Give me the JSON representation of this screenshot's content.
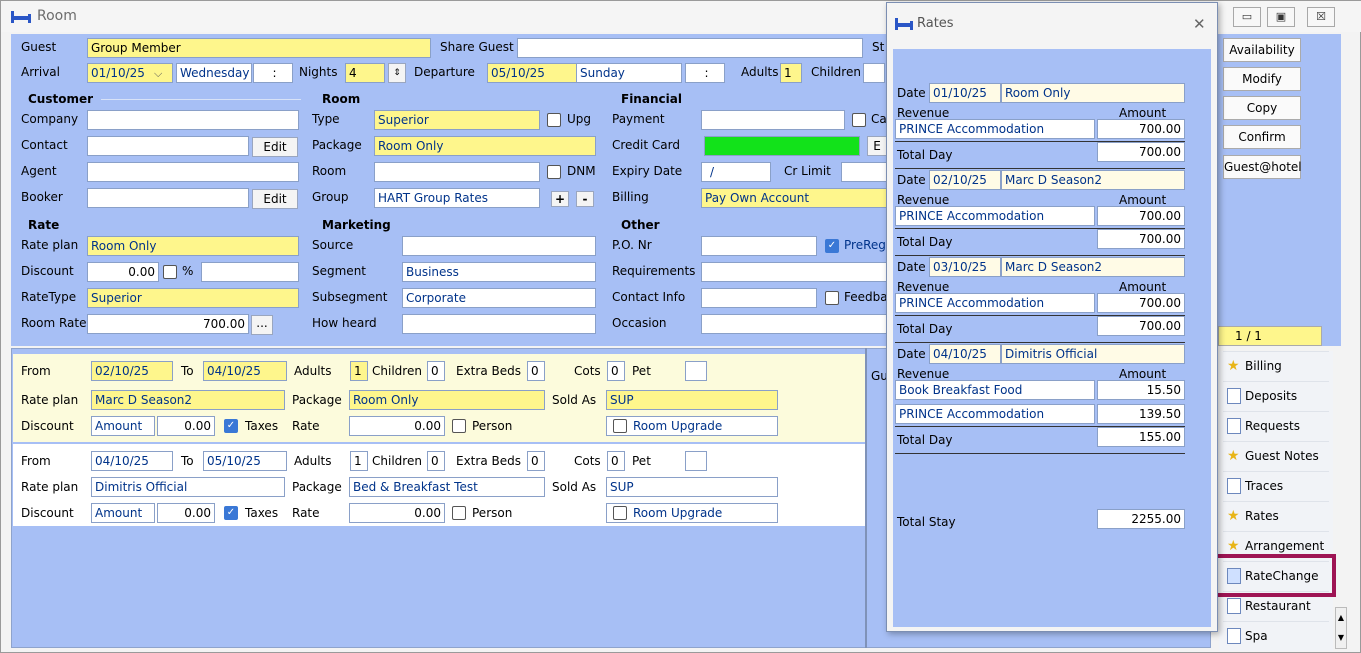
{
  "window": {
    "title": "Room",
    "min": "▭",
    "max": "▣",
    "close": "☒"
  },
  "guest": {
    "label": "Guest",
    "value": "Group Member",
    "share_label": "Share Guest",
    "share_value": "",
    "st_label": "St"
  },
  "arrival": {
    "label": "Arrival",
    "date": "01/10/25",
    "day": "Wednesday",
    "time": ":",
    "nights_label": "Nights",
    "nights": "4",
    "departure_label": "Departure",
    "dep_date": "05/10/25",
    "dep_day": "Sunday",
    "dep_time": ":",
    "adults_label": "Adults",
    "adults": "1",
    "children_label": "Children"
  },
  "customer": {
    "title": "Customer",
    "company": "Company",
    "contact": "Contact",
    "agent": "Agent",
    "booker": "Booker",
    "edit": "Edit"
  },
  "room": {
    "title": "Room",
    "type_label": "Type",
    "type": "Superior",
    "upg": "Upg",
    "package_label": "Package",
    "package": "Room Only",
    "room_label": "Room",
    "dnm": "DNM",
    "group_label": "Group",
    "group": "HART Group Rates",
    "plus": "+",
    "minus": "-"
  },
  "financial": {
    "title": "Financial",
    "payment": "Payment",
    "credit": "Credit Card",
    "expiry": "Expiry Date",
    "expiry_val": "/",
    "cr_limit": "Cr Limit",
    "billing": "Billing",
    "billing_val": "Pay Own Account",
    "ca": "Ca",
    "e": "E"
  },
  "rate": {
    "title": "Rate",
    "plan_label": "Rate plan",
    "plan": "Room Only",
    "discount_label": "Discount",
    "discount": "0.00",
    "pct": "%",
    "ratetype_label": "RateType",
    "ratetype": "Superior",
    "roomrate_label": "Room Rate",
    "roomrate": "700.00",
    "dots": "..."
  },
  "marketing": {
    "title": "Marketing",
    "source": "Source",
    "segment": "Segment",
    "segment_val": "Business",
    "subsegment": "Subsegment",
    "subsegment_val": "Corporate",
    "howheard": "How heard"
  },
  "other": {
    "title": "Other",
    "po": "P.O. Nr",
    "prereg": "PreReg",
    "requirements": "Requirements",
    "contact": "Contact Info",
    "feedback": "Feedba",
    "occasion": "Occasion"
  },
  "segments": [
    {
      "from_label": "From",
      "from": "02/10/25",
      "to_label": "To",
      "to": "04/10/25",
      "adults_label": "Adults",
      "adults": "1",
      "children_label": "Children",
      "children": "0",
      "extra_label": "Extra Beds",
      "extra": "0",
      "cots_label": "Cots",
      "cots": "0",
      "pet_label": "Pet",
      "plan_label": "Rate plan",
      "plan": "Marc D Season2",
      "package_label": "Package",
      "package": "Room Only",
      "sold_label": "Sold As",
      "sold": "SUP",
      "disc_label": "Discount",
      "disc_type": "Amount",
      "disc": "0.00",
      "taxes": "Taxes",
      "rate_label": "Rate",
      "rate": "0.00",
      "person": "Person",
      "upgrade": "Room Upgrade"
    },
    {
      "from_label": "From",
      "from": "04/10/25",
      "to_label": "To",
      "to": "05/10/25",
      "adults_label": "Adults",
      "adults": "1",
      "children_label": "Children",
      "children": "0",
      "extra_label": "Extra Beds",
      "extra": "0",
      "cots_label": "Cots",
      "cots": "0",
      "pet_label": "Pet",
      "plan_label": "Rate plan",
      "plan": "Dimitris Official",
      "package_label": "Package",
      "package": "Bed & Breakfast Test",
      "sold_label": "Sold As",
      "sold": "SUP",
      "disc_label": "Discount",
      "disc_type": "Amount",
      "disc": "0.00",
      "taxes": "Taxes",
      "rate_label": "Rate",
      "rate": "0.00",
      "person": "Person",
      "upgrade": "Room Upgrade"
    }
  ],
  "gu_label": "Gu",
  "side_buttons": [
    "Availability",
    "Modify",
    "Copy",
    "Confirm",
    "Guest@hotel"
  ],
  "page_counter": "1 / 1",
  "side_items": [
    "Billing",
    "Deposits",
    "Requests",
    "Guest Notes",
    "Traces",
    "Rates",
    "Arrangement",
    "RateChange",
    "Restaurant",
    "Spa"
  ],
  "rates_dialog": {
    "title": "Rates",
    "close": "✕",
    "date_label": "Date",
    "revenue_label": "Revenue",
    "amount_label": "Amount",
    "total_day_label": "Total Day",
    "days": [
      {
        "date": "01/10/25",
        "plan": "Room Only",
        "lines": [
          {
            "name": "PRINCE Accommodation",
            "amount": "700.00"
          }
        ],
        "total": "700.00"
      },
      {
        "date": "02/10/25",
        "plan": "Marc D Season2",
        "lines": [
          {
            "name": "PRINCE Accommodation",
            "amount": "700.00"
          }
        ],
        "total": "700.00"
      },
      {
        "date": "03/10/25",
        "plan": "Marc D Season2",
        "lines": [
          {
            "name": "PRINCE Accommodation",
            "amount": "700.00"
          }
        ],
        "total": "700.00"
      },
      {
        "date": "04/10/25",
        "plan": "Dimitris Official",
        "lines": [
          {
            "name": "Book Breakfast Food",
            "amount": "15.50"
          },
          {
            "name": "PRINCE Accommodation",
            "amount": "139.50"
          }
        ],
        "total": "155.00"
      }
    ],
    "total_stay_label": "Total Stay",
    "total_stay": "2255.00"
  }
}
